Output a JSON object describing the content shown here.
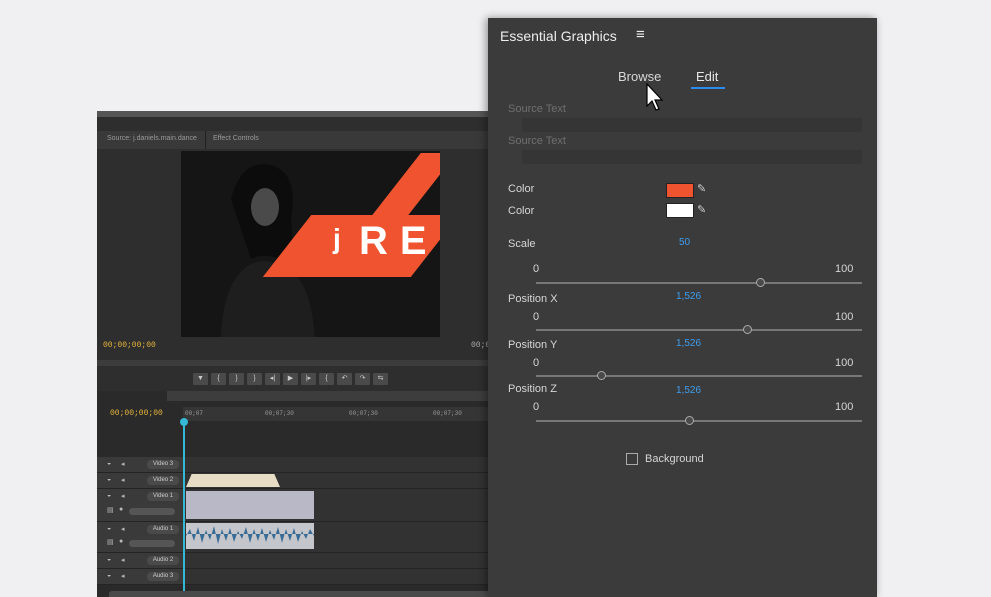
{
  "editor": {
    "source_tab": "Source: j.daniels.main.dance",
    "effect_tab": "Effect Controls",
    "preview_title": "RE",
    "preview_letter": "j",
    "source_timecode": "00;00;00;00",
    "source_timecode_right": "00;0",
    "transport_buttons": [
      "▼",
      "{",
      "}",
      "}",
      "◂|",
      "▶",
      "|▸",
      "{",
      "↶",
      "↷",
      "⇆"
    ],
    "timeline_timecode": "00;00;00;00",
    "ruler_labels": [
      "00;07",
      "00;07;30",
      "00;07;30",
      "00;07;30"
    ],
    "tracks": [
      "Video 3",
      "Video 2",
      "Video 1",
      "Audio 1",
      "Audio 2",
      "Audio 3"
    ]
  },
  "essential_graphics": {
    "title": "Essential Graphics",
    "menu_icon": "hamburger-icon",
    "tabs": {
      "browse": "Browse",
      "edit": "Edit",
      "active": "edit"
    },
    "source_text_1": "Source Text",
    "source_text_2": "Source Text",
    "color_label_1": "Color",
    "color_1": "#f0532f",
    "color_label_2": "Color",
    "color_2": "#ffffff",
    "scale": {
      "label": "Scale",
      "value": "50",
      "min": "0",
      "max": "100",
      "position": 0.69
    },
    "position_x": {
      "label": "Position X",
      "value": "1,526",
      "min": "0",
      "max": "100",
      "position": 0.65
    },
    "position_y": {
      "label": "Position Y",
      "value": "1,526",
      "min": "0",
      "max": "100",
      "position": 0.2
    },
    "position_z": {
      "label": "Position Z",
      "value": "1,526",
      "min": "0",
      "max": "100",
      "position": 0.47
    },
    "background_label": "Background",
    "background_checked": false
  },
  "colors": {
    "accent": "#2d8ceb",
    "value_blue": "#3d9ef0",
    "timecode": "#e8b63c",
    "playhead": "#35b8d6"
  }
}
